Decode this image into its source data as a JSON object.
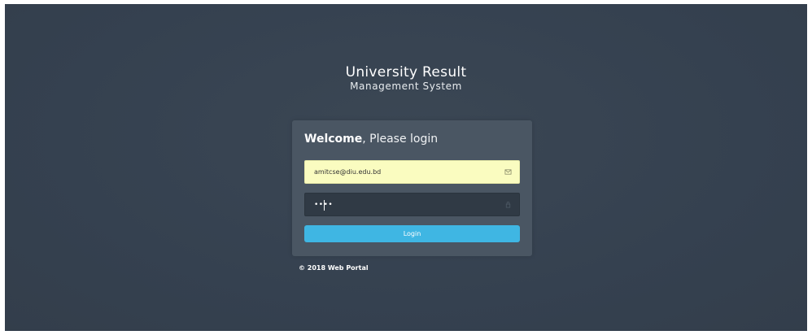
{
  "brand": {
    "line1": "University Result",
    "line2": "Management System"
  },
  "login_form": {
    "title_bold": "Welcome",
    "title_rest": ", Please login",
    "email": {
      "value": "amitcse@diu.edu.bd",
      "icon": "envelope-icon"
    },
    "password": {
      "value": "••••",
      "icon": "lock-icon"
    },
    "submit_label": "Login"
  },
  "footer": {
    "text": "© 2018 Web Portal"
  },
  "colors": {
    "background": "#37424f",
    "card": "#4a5663",
    "autofill": "#fafcc0",
    "password_field": "#303a45",
    "accent": "#3fb6e3"
  }
}
